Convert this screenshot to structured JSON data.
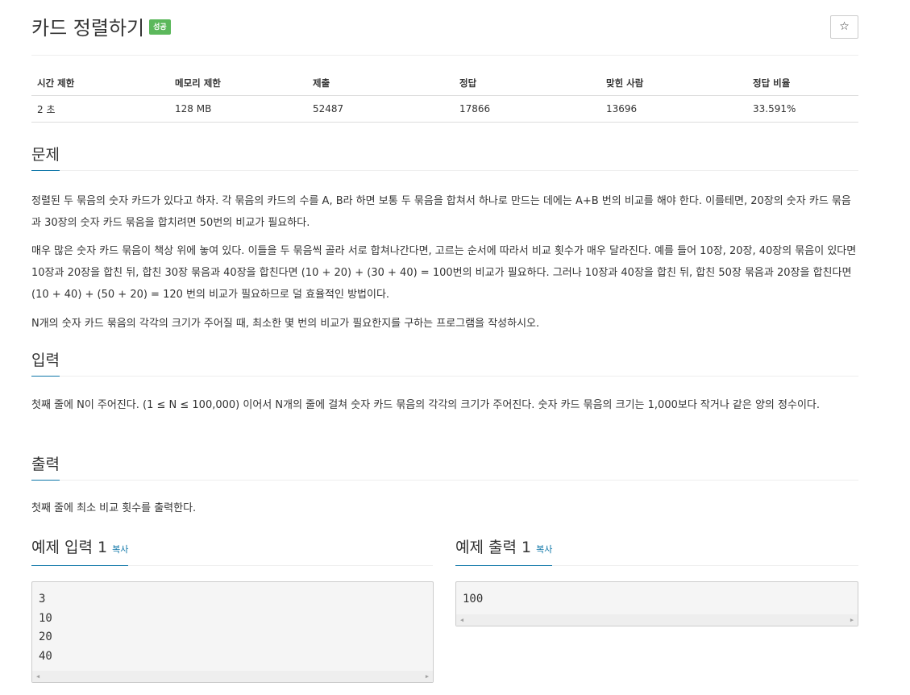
{
  "header": {
    "title": "카드 정렬하기",
    "badge": "성공",
    "star": "☆"
  },
  "info_table": {
    "headers": [
      "시간 제한",
      "메모리 제한",
      "제출",
      "정답",
      "맞힌 사람",
      "정답 비율"
    ],
    "values": [
      "2 초",
      "128 MB",
      "52487",
      "17866",
      "13696",
      "33.591%"
    ]
  },
  "problem": {
    "heading": "문제",
    "paragraphs": [
      "정렬된 두 묶음의 숫자 카드가 있다고 하자. 각 묶음의 카드의 수를 A, B라 하면 보통 두 묶음을 합쳐서 하나로 만드는 데에는 A+B 번의 비교를 해야 한다. 이를테면, 20장의 숫자 카드 묶음과 30장의 숫자 카드 묶음을 합치려면 50번의 비교가 필요하다.",
      "매우 많은 숫자 카드 묶음이 책상 위에 놓여 있다. 이들을 두 묶음씩 골라 서로 합쳐나간다면, 고르는 순서에 따라서 비교 횟수가 매우 달라진다. 예를 들어 10장, 20장, 40장의 묶음이 있다면 10장과 20장을 합친 뒤, 합친 30장 묶음과 40장을 합친다면 (10 + 20) + (30 + 40) = 100번의 비교가 필요하다. 그러나 10장과 40장을 합친 뒤, 합친 50장 묶음과 20장을 합친다면 (10 + 40) + (50 + 20) = 120 번의 비교가 필요하므로 덜 효율적인 방법이다.",
      "N개의 숫자 카드 묶음의 각각의 크기가 주어질 때, 최소한 몇 번의 비교가 필요한지를 구하는 프로그램을 작성하시오."
    ]
  },
  "input": {
    "heading": "입력",
    "text": "첫째 줄에 N이 주어진다. (1 ≤ N ≤ 100,000) 이어서 N개의 줄에 걸쳐 숫자 카드 묶음의 각각의 크기가 주어진다. 숫자 카드 묶음의 크기는 1,000보다 작거나 같은 양의 정수이다."
  },
  "output": {
    "heading": "출력",
    "text": "첫째 줄에 최소 비교 횟수를 출력한다."
  },
  "samples": {
    "input": {
      "heading": "예제 입력 1",
      "copy": "복사",
      "content": "3\n10\n20\n40"
    },
    "output": {
      "heading": "예제 출력 1",
      "copy": "복사",
      "content": "100"
    }
  }
}
